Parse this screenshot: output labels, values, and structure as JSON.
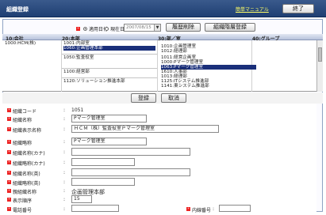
{
  "app": {
    "title": "組織登録",
    "manual_link": "簡単マニュアル",
    "close_label": "終了"
  },
  "filter": {
    "radio_apply_date": "適用日付",
    "radio_current_date": "現在日付",
    "date_value": "2007/08/15",
    "history_delete_label": "履歴削除",
    "tier_register_label": "組織階層登録"
  },
  "grid": {
    "headers": [
      "10:会社",
      "20:本部",
      "30:部／室",
      "40:グループ"
    ],
    "company": "1000:HCM(株)",
    "honbu": [
      "1001:内部室",
      "1060:企画管理本部",
      "1050:監査役室",
      "1100:経営部",
      "1120:ソリューション推進本部"
    ],
    "bushitsu": [
      "1010:企画管理室",
      "1012:経理部",
      "1011:経営企画室",
      "1000:Pマーク管理室",
      "1063:Pマーク管理室",
      "1610:人事部",
      "1013:経理部",
      "1125:ITシステム推進部",
      "1141:東システム推進部"
    ]
  },
  "actions": {
    "register_label": "登録",
    "cancel_label": "取消"
  },
  "detail": {
    "code_label": "組織コード",
    "code_value": "1051",
    "name_label": "組織名称",
    "name_value": "Pマーク管理室",
    "display_name_label": "組織表示名称",
    "display_name_value": "ＨＣＭ（株）監査役室Ｐマーク管理室",
    "short_name_label": "組織略称",
    "short_name_value": "Pマーク管理室",
    "kana_name_label": "組織名称(カナ)",
    "kana_short_label": "組織略称(カナ)",
    "en_name_label": "組織名称(英)",
    "en_short_label": "組織略称(英)",
    "parent_label": "親組織名称",
    "parent_value": "企画管理本部",
    "order_label": "表示順序",
    "order_value": "15",
    "phone_label": "電話番号",
    "ext_label": "内線番号"
  }
}
